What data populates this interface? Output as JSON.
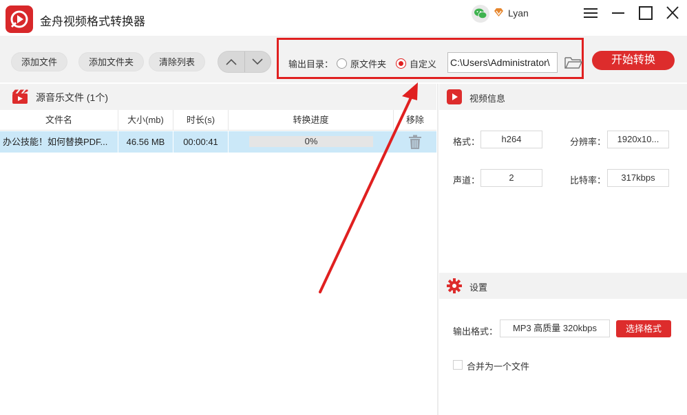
{
  "app": {
    "title": "金舟视频格式转换器",
    "username": "Lyan",
    "accent": "#dd2c2c"
  },
  "toolbar": {
    "add_file": "添加文件",
    "add_folder": "添加文件夹",
    "clear_list": "清除列表",
    "output_label": "输出目录：",
    "option_original": "原文件夹",
    "option_custom": "自定义",
    "selected_option": "自定义",
    "output_path": "C:\\Users\\Administrator\\",
    "start": "开始转换"
  },
  "file_list": {
    "title": "源音乐文件 (1个)",
    "columns": [
      "文件名",
      "大小(mb)",
      "时长(s)",
      "转换进度",
      "移除"
    ],
    "rows": [
      {
        "name": "办公技能！如何替换PDF...",
        "size": "46.56 MB",
        "duration": "00:00:41",
        "progress_text": "0%",
        "progress": 0
      }
    ]
  },
  "video_info": {
    "title": "视频信息",
    "format_label": "格式：",
    "format": "h264",
    "resolution_label": "分辨率：",
    "resolution": "1920x10...",
    "channels_label": "声道：",
    "channels": "2",
    "bitrate_label": "比特率：",
    "bitrate": "317kbps"
  },
  "settings": {
    "title": "设置",
    "output_format_label": "输出格式：",
    "output_format": "MP3 高质量 320kbps",
    "choose_format": "选择格式",
    "merge_label": "合并为一个文件",
    "merge_checked": false
  },
  "icons": [
    "app-logo-icon",
    "wechat-icon",
    "vip-icon",
    "menu-icon",
    "minimize-icon",
    "maximize-icon",
    "close-icon",
    "up-arrow-icon",
    "down-arrow-icon",
    "folder-icon",
    "film-icon",
    "trash-icon",
    "video-icon",
    "gear-icon"
  ]
}
